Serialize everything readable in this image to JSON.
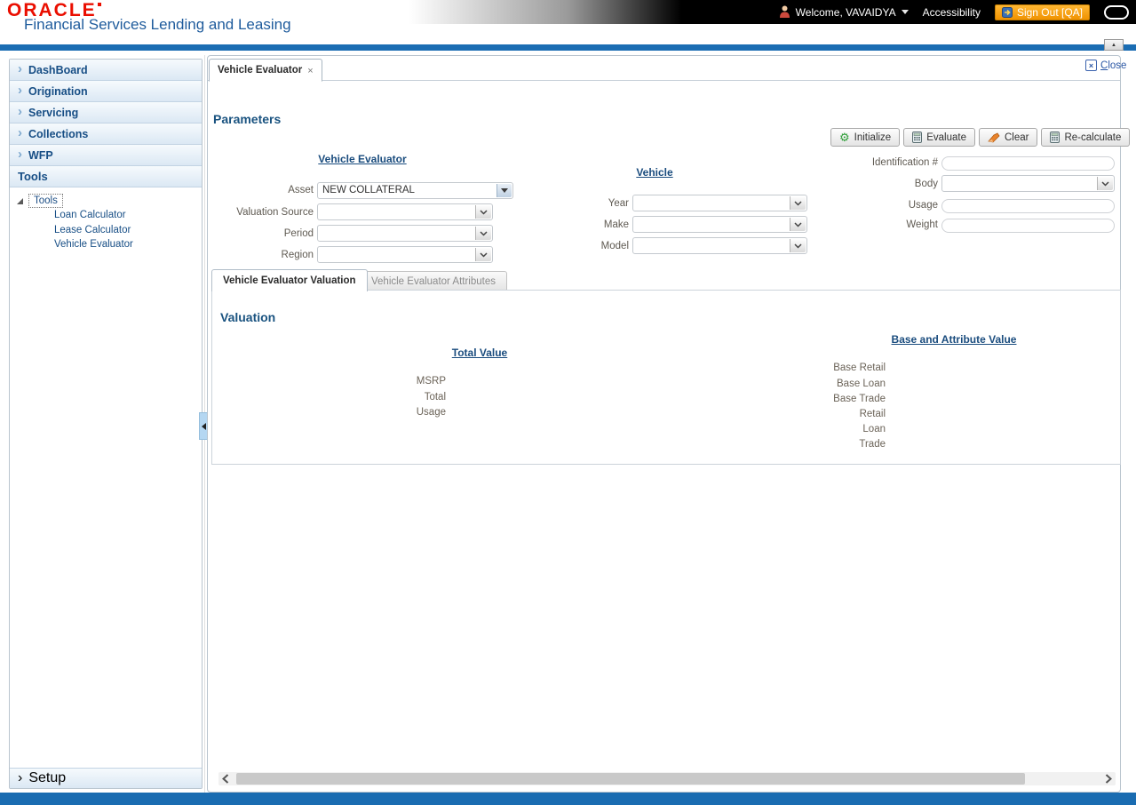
{
  "brand": {
    "logo": "ORACLE",
    "tagline": "Financial Services Lending and Leasing"
  },
  "topbar": {
    "welcome": "Welcome, VAVAIDYA",
    "accessibility": "Accessibility",
    "sign_out": "Sign Out [QA]"
  },
  "sidebar": {
    "items": [
      "DashBoard",
      "Origination",
      "Servicing",
      "Collections",
      "WFP"
    ],
    "tools_header": "Tools",
    "tree_root": "Tools",
    "tree_links": [
      "Loan Calculator",
      "Lease Calculator",
      "Vehicle Evaluator"
    ],
    "setup": "Setup"
  },
  "workspace": {
    "tab_title": "Vehicle Evaluator",
    "close_label": "Close"
  },
  "parameters": {
    "title": "Parameters",
    "buttons": [
      "Initialize",
      "Evaluate",
      "Clear",
      "Re-calculate"
    ],
    "evaluator": {
      "title": "Vehicle Evaluator",
      "asset_label": "Asset",
      "asset_value": "NEW COLLATERAL",
      "valuation_source_label": "Valuation Source",
      "period_label": "Period",
      "region_label": "Region"
    },
    "vehicle": {
      "title": "Vehicle",
      "year_label": "Year",
      "make_label": "Make",
      "model_label": "Model"
    },
    "details": {
      "identification_label": "Identification #",
      "body_label": "Body",
      "usage_label": "Usage",
      "weight_label": "Weight"
    }
  },
  "subtabs": {
    "active": "Vehicle Evaluator Valuation",
    "inactive": "Vehicle Evaluator Attributes"
  },
  "valuation": {
    "title": "Valuation",
    "total_value_title": "Total Value",
    "total_value_labels": [
      "MSRP",
      "Total",
      "Usage"
    ],
    "base_attr_title": "Base and Attribute Value",
    "base_attr_labels": [
      "Base Retail",
      "Base Loan",
      "Base Trade",
      "Retail",
      "Loan",
      "Trade"
    ]
  },
  "icons": {
    "nav_chevron": "›",
    "tab_close": "×",
    "close_x": "×",
    "gear": "⚙",
    "caret_up": "▲"
  },
  "colors": {
    "accent_blue": "#1b6db3",
    "oracle_red": "#ea0e00",
    "navy_heading": "#1a4c7e",
    "signout_orange": "#f09200"
  }
}
